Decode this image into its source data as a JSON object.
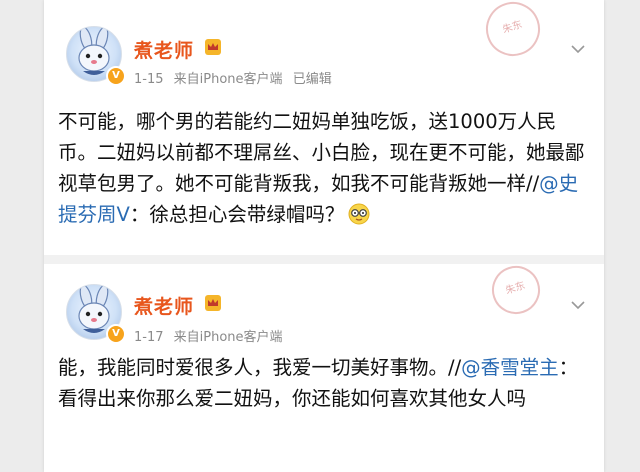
{
  "posts": [
    {
      "author": "煮老师",
      "date": "1-15",
      "source": "来自iPhone客户端",
      "edited": "已编辑",
      "body_pre": "不可能，哪个男的若能约二妞妈单独吃饭，送1000万人民币。二妞妈以前都不理屌丝、小白脸，现在更不可能，她最鄙视草包男了。她不可能背叛我，如我不可能背叛她一样//",
      "mention": "@史提芬周V",
      "body_post": "：徐总担心会带绿帽吗？",
      "emoji": "glasses-face-emoji",
      "stamp_text": "朱东"
    },
    {
      "author": "煮老师",
      "date": "1-17",
      "source": "来自iPhone客户端",
      "body_pre": "能，我能同时爱很多人，我爱一切美好事物。//",
      "mention": "@香雪堂主",
      "body_post": "：看得出来你那么爱二妞妈，你还能如何喜欢其他女人吗",
      "stamp_text": "朱东"
    }
  ],
  "colors": {
    "author": "#e8561d",
    "mention": "#2a6bb3",
    "meta": "#8a8a8a",
    "verified": "#f7a31c"
  },
  "icons": {
    "verified": "v-badge-icon",
    "member": "crown-icon",
    "menu": "chevron-down-icon"
  }
}
